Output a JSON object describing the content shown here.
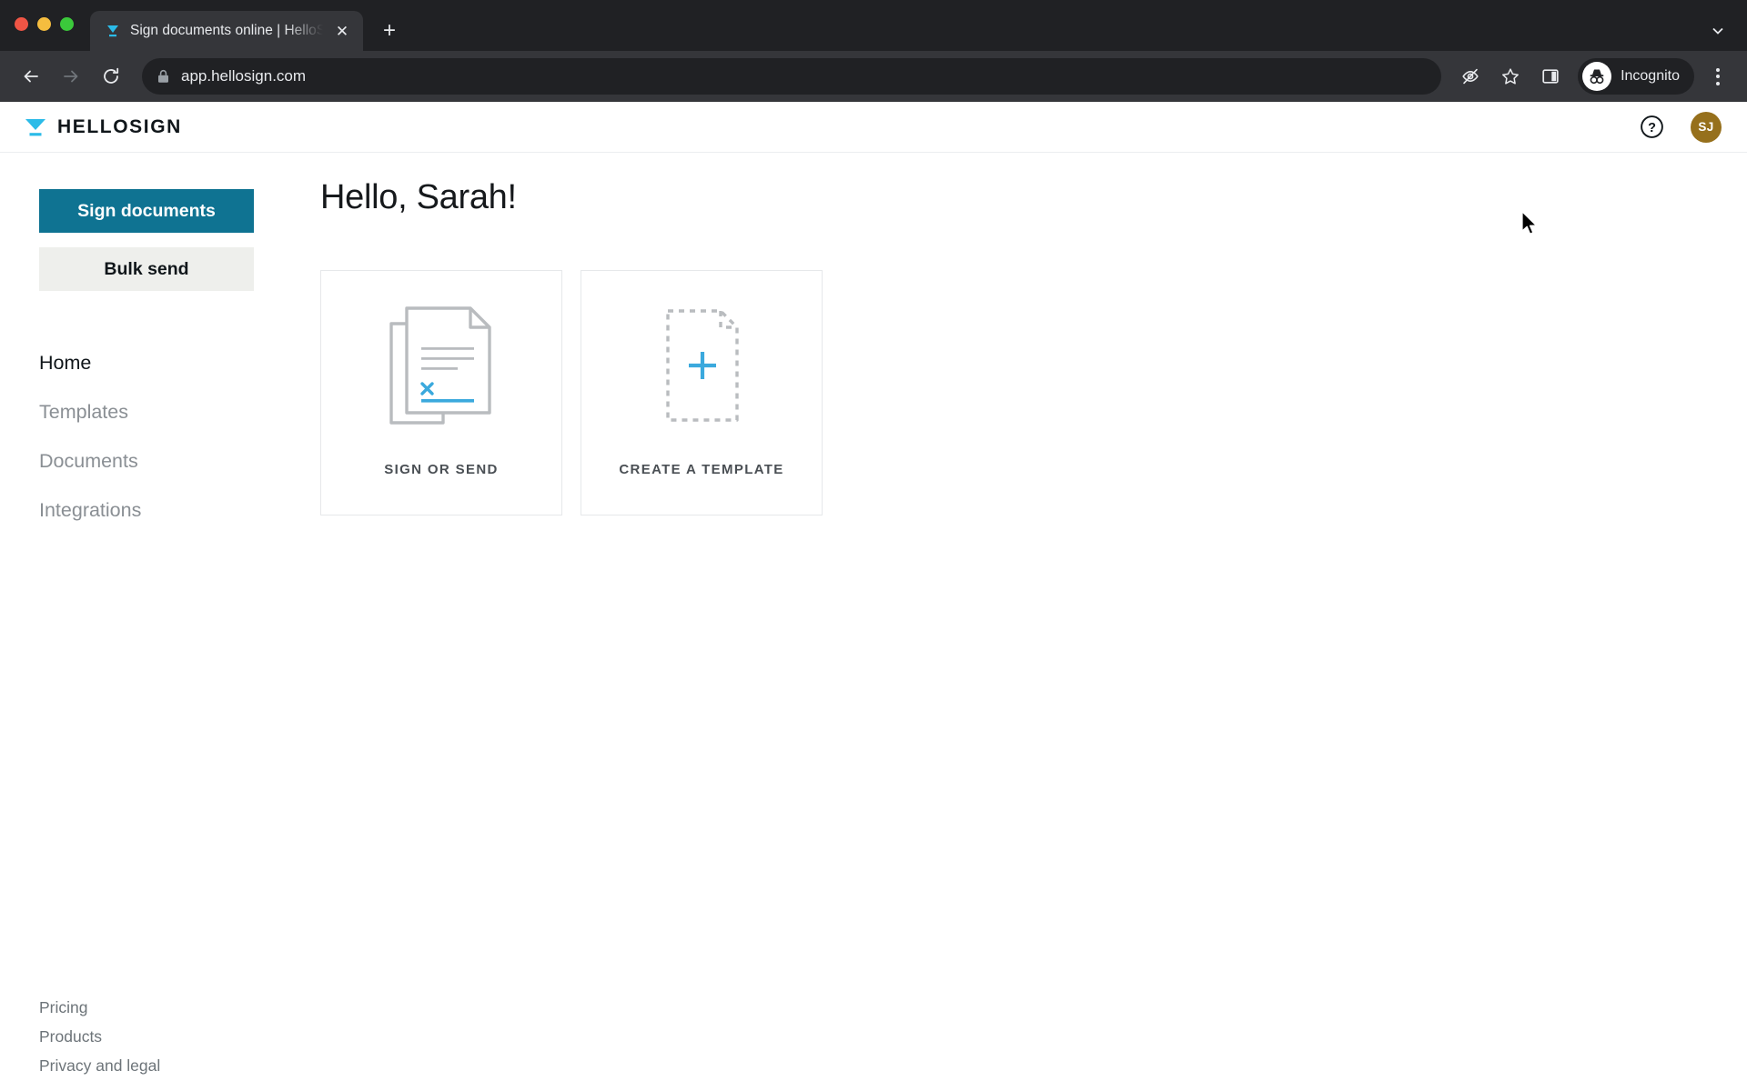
{
  "browser": {
    "window_controls": [
      "close",
      "minimize",
      "maximize"
    ],
    "tab": {
      "title": "Sign documents online | HelloS",
      "favicon": "hellosign-logo-icon",
      "close_label": "✕"
    },
    "new_tab_label": "+",
    "tab_list_chevron": "chevron-down-icon",
    "nav": {
      "back_label": "←",
      "forward_label": "→",
      "reload_label": "↻"
    },
    "omnibox": {
      "security_icon": "lock-icon",
      "url": "app.hellosign.com"
    },
    "toolbar_right": {
      "tracking_protection_icon": "eye-slash-icon",
      "bookmark_icon": "star-icon",
      "side_panel_icon": "side-panel-icon",
      "profile_label": "Incognito",
      "profile_icon": "incognito-hat-icon",
      "menu_icon": "kebab-menu-icon"
    }
  },
  "app": {
    "header": {
      "brand_name": "HELLOSIGN",
      "brand_logo": "hellosign-triangle-icon",
      "help_label": "?",
      "avatar_initials": "SJ"
    },
    "sidebar": {
      "primary_button": "Sign documents",
      "secondary_button": "Bulk send",
      "nav_items": [
        {
          "label": "Home",
          "active": true
        },
        {
          "label": "Templates",
          "active": false
        },
        {
          "label": "Documents",
          "active": false
        },
        {
          "label": "Integrations",
          "active": false
        }
      ],
      "footer_links": [
        "Pricing",
        "Products",
        "Privacy and legal"
      ]
    },
    "main": {
      "greeting": "Hello, Sarah!",
      "cards": [
        {
          "label": "SIGN OR SEND",
          "icon": "signed-document-icon"
        },
        {
          "label": "CREATE A TEMPLATE",
          "icon": "new-template-icon"
        }
      ]
    }
  },
  "colors": {
    "brand_cyan": "#2bbbe8",
    "primary_teal": "#0f7392",
    "accent_blue": "#3ba9dd",
    "avatar_gold": "#96701c",
    "chrome_dark": "#202124",
    "chrome_toolbar": "#35363a"
  }
}
